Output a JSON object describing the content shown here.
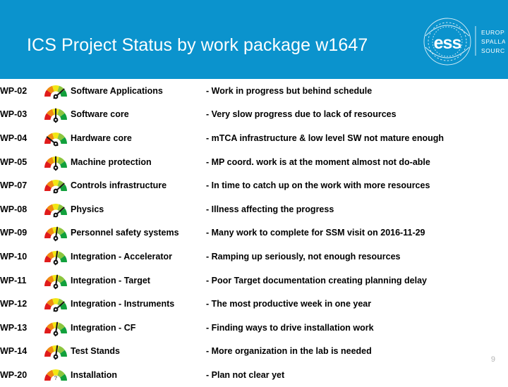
{
  "header": {
    "title": "ICS Project Status by work package w1647",
    "background_color": "#0b93cd",
    "title_color": "#ffffff",
    "logo": {
      "wordmark": "ess",
      "line1": "EUROPEAN",
      "line2": "SPALLATION",
      "line3": "SOURCE"
    }
  },
  "gauge_colors": {
    "red": "#e01b1b",
    "orange": "#f08a10",
    "yellow": "#f2e713",
    "light_green": "#8cc63e",
    "green": "#12a03c",
    "needle": "#1a1a1a",
    "hub": "#111111"
  },
  "rows": [
    {
      "code": "WP-02",
      "name": "Software Applications",
      "comment": "- Work in progress but behind schedule",
      "gauge": {
        "state": "needle",
        "angle": 48,
        "label": "green"
      }
    },
    {
      "code": "WP-03",
      "name": "Software core",
      "comment": "- Very slow progress due to lack of resources",
      "gauge": {
        "state": "needle",
        "angle": 0,
        "label": "yellow"
      }
    },
    {
      "code": "WP-04",
      "name": "Hardware core",
      "comment": "- mTCA infrastructure & low level SW not mature enough",
      "gauge": {
        "state": "needle",
        "angle": -52,
        "label": "orange"
      }
    },
    {
      "code": "WP-05",
      "name": "Machine protection",
      "comment": "- MP coord. work is at the moment almost not do-able",
      "gauge": {
        "state": "needle",
        "angle": 0,
        "label": "yellow"
      }
    },
    {
      "code": "WP-07",
      "name": "Controls infrastructure",
      "comment": "- In time to catch up on the work with more resources",
      "gauge": {
        "state": "needle",
        "angle": 48,
        "label": "green"
      }
    },
    {
      "code": "WP-08",
      "name": "Physics",
      "comment": "- Illness affecting the progress",
      "gauge": {
        "state": "needle",
        "angle": 48,
        "label": "green"
      }
    },
    {
      "code": "WP-09",
      "name": "Personnel safety systems",
      "comment": "- Many work to complete for SSM visit on 2016-11-29",
      "gauge": {
        "state": "needle",
        "angle": 8,
        "label": "yellow"
      }
    },
    {
      "code": "WP-10",
      "name": "Integration - Accelerator",
      "comment": "- Ramping up seriously, not enough resources",
      "gauge": {
        "state": "needle",
        "angle": 8,
        "label": "yellow"
      }
    },
    {
      "code": "WP-11",
      "name": "Integration - Target",
      "comment": "- Poor Target documentation creating planning delay",
      "gauge": {
        "state": "needle",
        "angle": 8,
        "label": "yellow"
      }
    },
    {
      "code": "WP-12",
      "name": "Integration - Instruments",
      "comment": "- The most productive week in one year",
      "gauge": {
        "state": "needle",
        "angle": 48,
        "label": "green"
      }
    },
    {
      "code": "WP-13",
      "name": "Integration - CF",
      "comment": "- Finding ways to drive installation work",
      "gauge": {
        "state": "needle",
        "angle": 8,
        "label": "yellow"
      }
    },
    {
      "code": "WP-14",
      "name": "Test Stands",
      "comment": "- More organization in the lab is needed",
      "gauge": {
        "state": "needle",
        "angle": 8,
        "label": "yellow"
      }
    },
    {
      "code": "WP-20",
      "name": "Installation",
      "comment": "- Plan not clear yet",
      "gauge": {
        "state": "question",
        "angle": 0,
        "label": "unknown"
      }
    }
  ],
  "footer": {
    "page_number": "9"
  }
}
